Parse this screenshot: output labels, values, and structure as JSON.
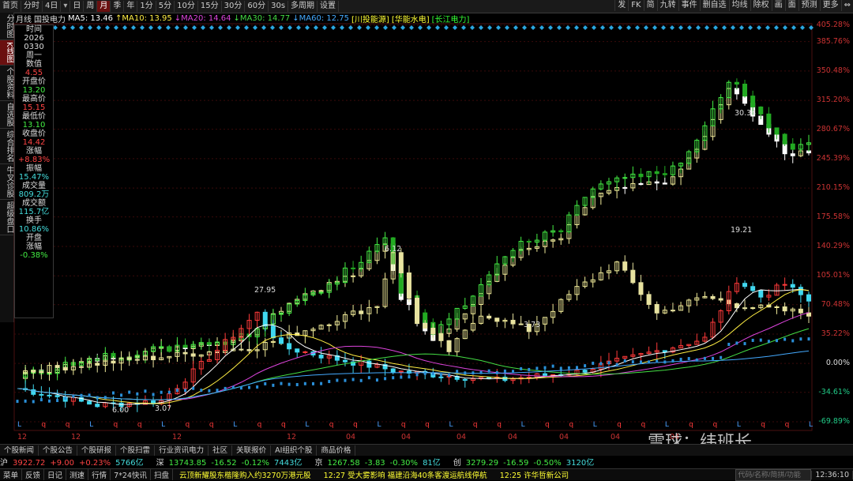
{
  "topbar": {
    "items": [
      "首页",
      "分时",
      "4日",
      "日",
      "周",
      "月",
      "季",
      "年",
      "1分",
      "5分",
      "10分",
      "15分",
      "30分",
      "60分",
      "30s",
      "多周期",
      "设置"
    ],
    "active": "月",
    "right_items": [
      "发",
      "FK",
      "简",
      "九转",
      "事件",
      "删自选",
      "均线",
      "除权",
      "画",
      "面",
      "预测",
      "更多",
      "⇔"
    ]
  },
  "leftnav": {
    "items": [
      "分时图",
      "K线图",
      "个股资料",
      "自选股",
      "综合排名",
      "牛叉诊股",
      "超级盘口"
    ],
    "active": "K线图"
  },
  "legend": {
    "items": [
      {
        "text": "月线",
        "color": "#dddddd"
      },
      {
        "text": "国投电力",
        "color": "#dddddd"
      },
      {
        "text": "MA5: 13.46",
        "color": "#ffffff"
      },
      {
        "text": "↑MA10: 13.95",
        "color": "#ffee44"
      },
      {
        "text": "↓MA20: 14.64",
        "color": "#dd44dd"
      },
      {
        "text": "↓MA30: 14.77",
        "color": "#44dd44"
      },
      {
        "text": "↓MA60: 12.75",
        "color": "#44aaff"
      },
      {
        "text": "[川投能源]",
        "color": "#ffff33"
      },
      {
        "text": "[华能水电]",
        "color": "#ffff33"
      },
      {
        "text": "[长江电力]",
        "color": "#33ff33"
      }
    ]
  },
  "info_panel": {
    "rows": [
      {
        "t": "时间",
        "c": "#dddddd"
      },
      {
        "t": "2026",
        "c": "#dddddd"
      },
      {
        "t": "0330",
        "c": "#dddddd"
      },
      {
        "t": "周一",
        "c": "#dddddd"
      },
      {
        "t": "数值",
        "c": "#dddddd"
      },
      {
        "t": "4.55",
        "c": "#ff4444"
      },
      {
        "t": "开盘价",
        "c": "#dddddd"
      },
      {
        "t": "13.20",
        "c": "#44ee44"
      },
      {
        "t": "最高价",
        "c": "#dddddd"
      },
      {
        "t": "15.15",
        "c": "#ff4444"
      },
      {
        "t": "最低价",
        "c": "#dddddd"
      },
      {
        "t": "13.10",
        "c": "#44ee44"
      },
      {
        "t": "收盘价",
        "c": "#dddddd"
      },
      {
        "t": "14.42",
        "c": "#ff4444"
      },
      {
        "t": "涨幅",
        "c": "#dddddd"
      },
      {
        "t": "+8.83%",
        "c": "#ff4444"
      },
      {
        "t": "振幅",
        "c": "#dddddd"
      },
      {
        "t": "15.47%",
        "c": "#44dddd"
      },
      {
        "t": "成交量",
        "c": "#dddddd"
      },
      {
        "t": "809.2万",
        "c": "#44dddd"
      },
      {
        "t": "成交额",
        "c": "#dddddd"
      },
      {
        "t": "115.7亿",
        "c": "#44dddd"
      },
      {
        "t": "换手",
        "c": "#dddddd"
      },
      {
        "t": "10.86%",
        "c": "#44dddd"
      },
      {
        "t": "开盘",
        "c": "#dddddd"
      },
      {
        "t": "涨幅",
        "c": "#dddddd"
      },
      {
        "t": "-0.38%",
        "c": "#44ee44"
      }
    ]
  },
  "chart_data": {
    "type": "candlestick",
    "y_axis_percent_labels": [
      "405.28%",
      "385.76%",
      "350.48%",
      "315.20%",
      "280.67%",
      "245.39%",
      "210.15%",
      "175.58%",
      "140.29%",
      "105.01%",
      "70.48%",
      "35.22%",
      "0.00%",
      "-34.61%",
      "-69.89%"
    ],
    "y_axis_percent_values": [
      405.28,
      385.76,
      350.48,
      315.2,
      280.67,
      245.39,
      210.15,
      175.58,
      140.29,
      105.01,
      70.48,
      35.22,
      0.0,
      -34.61,
      -69.89
    ],
    "x_axis_labels": [
      "12",
      "12",
      "12",
      "12",
      "04",
      "04",
      "04",
      "04",
      "04",
      "04",
      "04"
    ],
    "annotations": [
      {
        "label": "6.00",
        "series": "国投电力"
      },
      {
        "label": "3.07",
        "series": "国投电力"
      },
      {
        "label": "27.95",
        "series": "overlay"
      },
      {
        "label": "6.12",
        "series": "overlay"
      },
      {
        "label": "3.73",
        "series": "overlay"
      },
      {
        "label": "30.34",
        "series": "overlay"
      },
      {
        "label": "19.21",
        "series": "国投电力"
      }
    ],
    "series": [
      {
        "name": "国投电力",
        "style": "candle-red-cyan"
      },
      {
        "name": "川投能源",
        "style": "candle-yellow"
      },
      {
        "name": "华能水电",
        "style": "candle-yellow"
      },
      {
        "name": "长江电力",
        "style": "candle-green"
      }
    ]
  },
  "bottom_tabs": [
    "个股新闻",
    "个股公告",
    "个股研报",
    "个股扫雷",
    "行业资讯电力",
    "社区",
    "关联报价",
    "AI组织个股",
    "商品价格"
  ],
  "ticker": [
    {
      "name": "沪",
      "price": "3922.72",
      "chg": "+9.00",
      "pct": "+0.23%",
      "amt": "5766亿",
      "up": true
    },
    {
      "name": "深",
      "price": "13743.85",
      "chg": "-16.52",
      "pct": "-0.12%",
      "amt": "7443亿",
      "up": false
    },
    {
      "name": "京",
      "price": "1267.58",
      "chg": "-3.83",
      "pct": "-0.30%",
      "amt": "81亿",
      "up": false
    },
    {
      "name": "创",
      "price": "3279.29",
      "chg": "-16.59",
      "pct": "-0.50%",
      "amt": "3120亿",
      "up": false
    }
  ],
  "statusbar": {
    "items": [
      "菜单",
      "反馈",
      "日记",
      "测速",
      "行情",
      "7*24快讯",
      "扫盘"
    ],
    "news": [
      "云顶新耀股东楷隆购入约3270万港元股",
      "12:27 受大雾影响 福建沿海40条客渡运航线停航",
      "12:25 许华哲新公司"
    ],
    "search_placeholder": "代码/名称/简拼/功能",
    "time": "12:36:10"
  },
  "watermark": "雪球：纬班长"
}
